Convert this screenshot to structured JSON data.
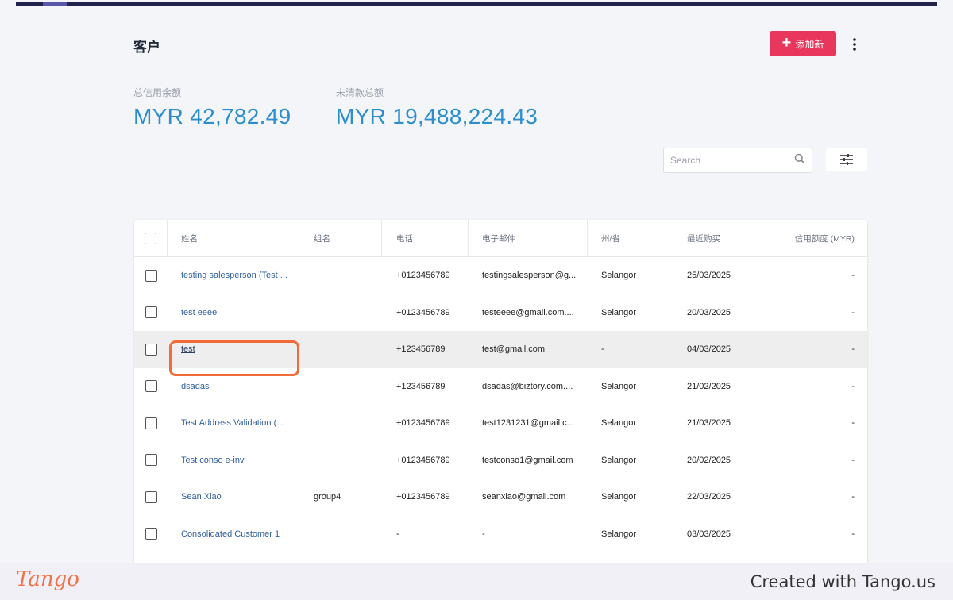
{
  "header": {
    "title": "客户",
    "add_button_label": "添加新",
    "more_icon": "more-vertical-icon"
  },
  "stats": [
    {
      "label": "总信用余额",
      "value": "MYR 42,782.49"
    },
    {
      "label": "未清款总额",
      "value": "MYR 19,488,224.43"
    }
  ],
  "search": {
    "placeholder": "Search",
    "value": ""
  },
  "table": {
    "columns": [
      "姓名",
      "组名",
      "电话",
      "电子邮件",
      "州/省",
      "最近购买",
      "信用额度 (MYR)"
    ],
    "rows": [
      {
        "name": "testing salesperson (Test ...",
        "group": "",
        "phone": "+0123456789",
        "email": "testingsalesperson@g...",
        "state": "Selangor",
        "last_purchase": "25/03/2025",
        "credit": "-"
      },
      {
        "name": "test eeee",
        "group": "",
        "phone": "+0123456789",
        "email": "testeeee@gmail.com....",
        "state": "Selangor",
        "last_purchase": "20/03/2025",
        "credit": "-"
      },
      {
        "name": "test",
        "group": "",
        "phone": "+123456789",
        "email": "test@gmail.com",
        "state": "-",
        "last_purchase": "04/03/2025",
        "credit": "-"
      },
      {
        "name": "dsadas",
        "group": "",
        "phone": "+123456789",
        "email": "dsadas@biztory.com....",
        "state": "Selangor",
        "last_purchase": "21/02/2025",
        "credit": "-"
      },
      {
        "name": "Test Address Validation (...",
        "group": "",
        "phone": "+0123456789",
        "email": "test1231231@gmail.c...",
        "state": "Selangor",
        "last_purchase": "21/03/2025",
        "credit": "-"
      },
      {
        "name": "Test conso e-inv",
        "group": "",
        "phone": "+0123456789",
        "email": "testconso1@gmail.com",
        "state": "Selangor",
        "last_purchase": "20/02/2025",
        "credit": "-"
      },
      {
        "name": "Sean Xiao",
        "group": "group4",
        "phone": "+0123456789",
        "email": "seanxiao@gmail.com",
        "state": "Selangor",
        "last_purchase": "22/03/2025",
        "credit": "-"
      },
      {
        "name": "Consolidated Customer 1",
        "group": "",
        "phone": "-",
        "email": "-",
        "state": "Selangor",
        "last_purchase": "03/03/2025",
        "credit": "-"
      }
    ]
  },
  "footer": {
    "logo": "Tango",
    "created_text": "Created with Tango.us"
  },
  "colors": {
    "accent": "#e8365d",
    "stat_value": "#2b8fce",
    "link": "#2f5f9e",
    "highlight_outline": "#f26c3a"
  }
}
